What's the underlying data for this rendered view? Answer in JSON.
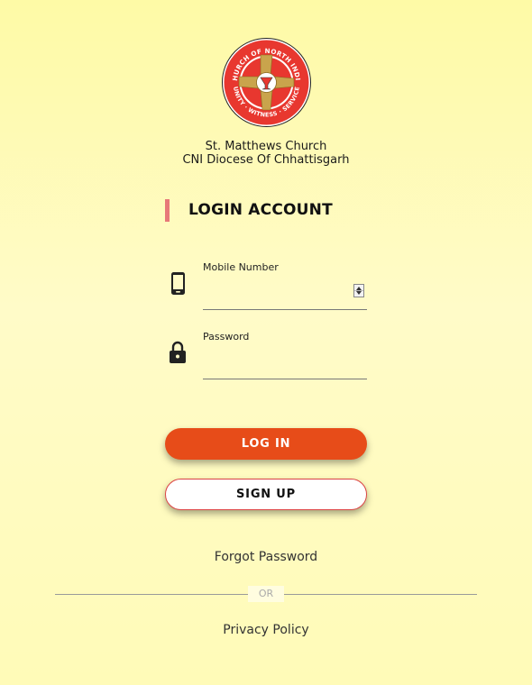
{
  "logo": {
    "ring_text_top": "CHURCH OF NORTH INDIA",
    "ring_text_bottom": "UNITY · WITNESS · SERVICE",
    "colors": {
      "ring": "#e8372f",
      "cross": "#c9a44c",
      "outline": "#222222"
    }
  },
  "church": {
    "name": "St. Matthews Church",
    "diocese": "CNI Diocese Of Chhattisgarh"
  },
  "heading": "LOGIN ACCOUNT",
  "fields": {
    "mobile": {
      "label": "Mobile Number",
      "value": "",
      "placeholder": "",
      "icon": "mobile-phone-icon"
    },
    "password": {
      "label": "Password",
      "value": "",
      "placeholder": "",
      "icon": "lock-icon"
    }
  },
  "buttons": {
    "login": "LOG IN",
    "signup": "SIGN UP"
  },
  "links": {
    "forgot": "Forgot Password",
    "or": "OR",
    "privacy": "Privacy Policy"
  },
  "colors": {
    "background": "#fefaa6",
    "primary": "#e74c19",
    "accent_bar": "#e77878",
    "signup_border": "#dd4444"
  }
}
